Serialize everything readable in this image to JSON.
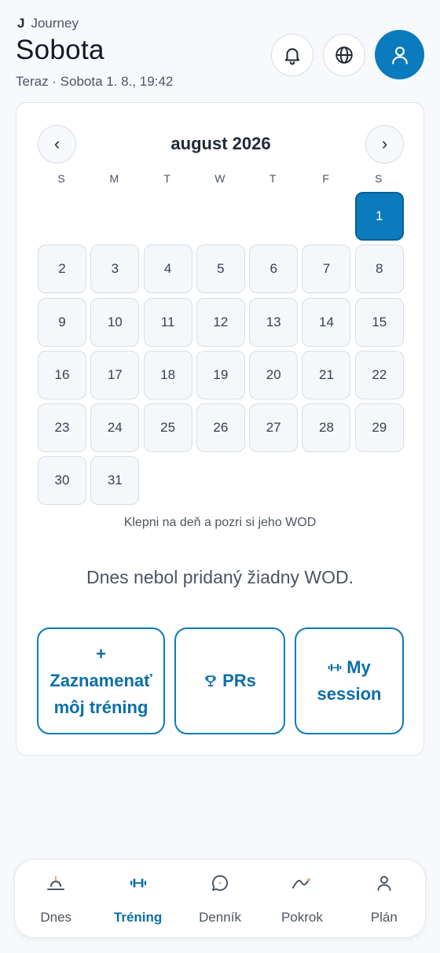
{
  "header": {
    "brand_mark": "J",
    "brand_name": "Journey",
    "day_title": "Sobota",
    "now_line": "Teraz · Sobota 1. 8., 19:42"
  },
  "calendar": {
    "month_label": "august 2026",
    "prev_symbol": "‹",
    "next_symbol": "›",
    "weekdays": [
      "S",
      "M",
      "T",
      "W",
      "T",
      "F",
      "S"
    ],
    "leading_blank_days": 6,
    "days": [
      "1",
      "2",
      "3",
      "4",
      "5",
      "6",
      "7",
      "8",
      "9",
      "10",
      "11",
      "12",
      "13",
      "14",
      "15",
      "16",
      "17",
      "18",
      "19",
      "20",
      "21",
      "22",
      "23",
      "24",
      "25",
      "26",
      "27",
      "28",
      "29",
      "30",
      "31"
    ],
    "selected_day": "1",
    "hint": "Klepni na deň a pozri si jeho WOD",
    "empty_message": "Dnes nebol pridaný žiadny WOD."
  },
  "actions": {
    "log_plus": "+",
    "log_label": "Zaznamenať môj tréning",
    "prs_label": "PRs",
    "session_label": "My session"
  },
  "bottom_nav": [
    {
      "label": "Dnes",
      "icon": "sunrise-icon",
      "active": false
    },
    {
      "label": "Tréning",
      "icon": "dumbbell-icon",
      "active": true
    },
    {
      "label": "Denník",
      "icon": "chat-bubble-icon",
      "active": false
    },
    {
      "label": "Pokrok",
      "icon": "trend-line-icon",
      "active": false
    },
    {
      "label": "Plán",
      "icon": "person-icon",
      "active": false
    }
  ],
  "colors": {
    "accent": "#0b7bbd",
    "accent_text": "#0b6fa8",
    "background": "#f7f9fc",
    "trend_dot": "#f0a56a"
  }
}
